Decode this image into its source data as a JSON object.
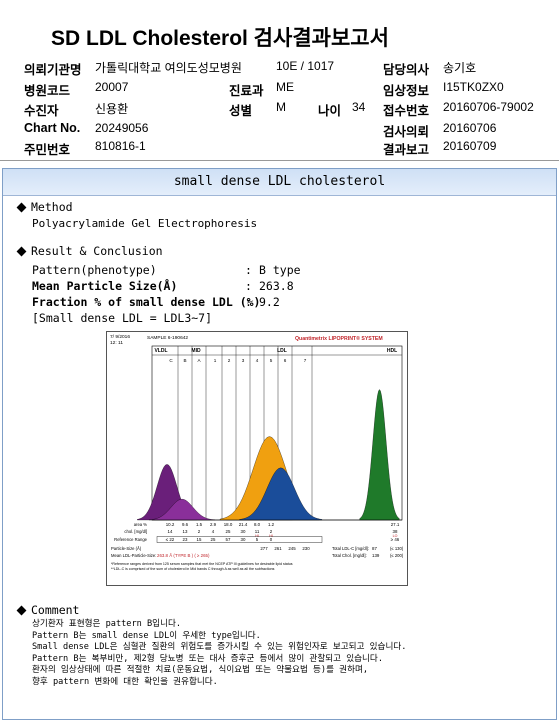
{
  "header": {
    "title": "SD LDL Cholesterol 검사결과보고서",
    "rows": [
      [
        {
          "label": "의뢰기관명",
          "value": "가톨릭대학교 여의도성모병원"
        },
        {
          "label": "병동",
          "value": "10E / 1017"
        },
        {
          "label": "담당의사",
          "value": "송기호"
        }
      ],
      [
        {
          "label": "병원코드",
          "value": "20007"
        },
        {
          "label": "진료과",
          "value": "ME"
        },
        {
          "label": "임상정보",
          "value": "I15TK0ZX0"
        }
      ],
      [
        {
          "label": "수진자",
          "value": "신용환"
        },
        {
          "label": "성별",
          "value": "M"
        },
        {
          "label": "나이",
          "value": "34"
        },
        {
          "label": "접수번호",
          "value": "20160706-79002"
        }
      ],
      [
        {
          "label": "Chart No.",
          "value": "20249056"
        },
        {
          "label": "검사의뢰",
          "value": "20160706"
        }
      ],
      [
        {
          "label": "주민번호",
          "value": "810816-1"
        },
        {
          "label": "결과보고",
          "value": "20160709"
        }
      ]
    ]
  },
  "banner": "small dense LDL cholesterol",
  "method": {
    "heading": "Method",
    "text": "Polyacrylamide Gel Electrophoresis"
  },
  "result": {
    "heading": "Result & Conclusion",
    "items": [
      {
        "label": "Pattern(phenotype)",
        "value": "B type"
      },
      {
        "label": "Mean Particle Size(Å)",
        "value": "263.8"
      },
      {
        "label": "Fraction % of small dense LDL (%)",
        "value": "9.2"
      }
    ],
    "note": "[Small dense LDL = LDL3~7]"
  },
  "chart_data": {
    "type": "area",
    "top_left": "7/ 9/2016\n12: 11",
    "sample_label": "SAMPLE    6-190642",
    "brand": "Quantimetrix LIPOPRINT® SYSTEM",
    "zones": [
      "VLDL",
      "MID",
      "LDL",
      "HDL"
    ],
    "bands": [
      "C",
      "B",
      "A",
      "1",
      "2",
      "3",
      "4",
      "5",
      "6",
      "7"
    ],
    "area_pct_label": "area %",
    "area_pct": [
      "10.2",
      "9.6",
      "1.5",
      "2.9",
      "18.0",
      "21.4",
      "8.0",
      "1.2",
      "",
      "27.1"
    ],
    "chol_label": "chol. [mg/dl]",
    "chol": [
      "14",
      "13",
      "2",
      "4",
      "25",
      "30",
      "11",
      "2",
      "",
      "38"
    ],
    "chol_flags": [
      "",
      "",
      "",
      "",
      "",
      "",
      "HI",
      "HI",
      "",
      "LO"
    ],
    "range_label": "Reference Range",
    "ranges": [
      "≤ 22",
      "23",
      "15",
      "25",
      "57",
      "30",
      "5",
      "0",
      "",
      "≥ 46"
    ],
    "size_label": "Particle-Size (Å)",
    "sizes": [
      "277",
      "261",
      "245",
      "230"
    ],
    "mean_label": "Mean LDL-Particle-Size:",
    "mean_value": "263.8 Å (TYPE B ) ( ≥ 265)",
    "total_ldl_label": "Total LDL-C [mg/dl]:",
    "total_ldl": "87",
    "total_ldl_ref": "(≤ 130)",
    "total_chol_label": "Total Chol. [mg/dl]:",
    "total_chol": "139",
    "total_chol_ref": "(≤ 200)",
    "footnote1": "*Reference ranges derived from 125 serum samples that met the NCEP ATP III guidelines for desirable lipid status",
    "footnote2": "**LDL-C is comprised of the sum of cholesterol in Mid bands C through A as well as all the subfractions",
    "peaks": [
      {
        "name": "VLDL",
        "color": "#6a1f7a",
        "x": 0.06,
        "height": 0.32,
        "width": 0.018
      },
      {
        "name": "MID",
        "color": "#8a2f9a",
        "x": 0.12,
        "height": 0.12,
        "width": 0.02
      },
      {
        "name": "LDL-1",
        "color": "#d04010",
        "x": 0.43,
        "height": 0.18,
        "width": 0.02
      },
      {
        "name": "LDL-2",
        "color": "#f0a010",
        "x": 0.47,
        "height": 0.48,
        "width": 0.03
      },
      {
        "name": "LDL-3",
        "color": "#1a4d9a",
        "x": 0.515,
        "height": 0.3,
        "width": 0.025
      },
      {
        "name": "HDL",
        "color": "#1f7a2a",
        "x": 0.91,
        "height": 0.75,
        "width": 0.012
      }
    ]
  },
  "comment": {
    "heading": "Comment",
    "lines": [
      "상기환자 표현형은 pattern B입니다.",
      "Pattern B는 small dense LDL이 우세한 type입니다.",
      "Small dense LDL은 심혈관 질환의 위험도를 증가시킬 수 있는 위험인자로 보고되고 있습니다.",
      "Pattern B는 복부비만, 제2형 당뇨병 또는 대사 증후군 등에서 많이 관찰되고 있습니다.",
      "환자의 임상상태에 따른 적절한 치료(운동요법, 식이요법 또는 약물요법 등)를 권하며,",
      "향후 pattern 변화에 대한 확인을 권유합니다."
    ]
  }
}
